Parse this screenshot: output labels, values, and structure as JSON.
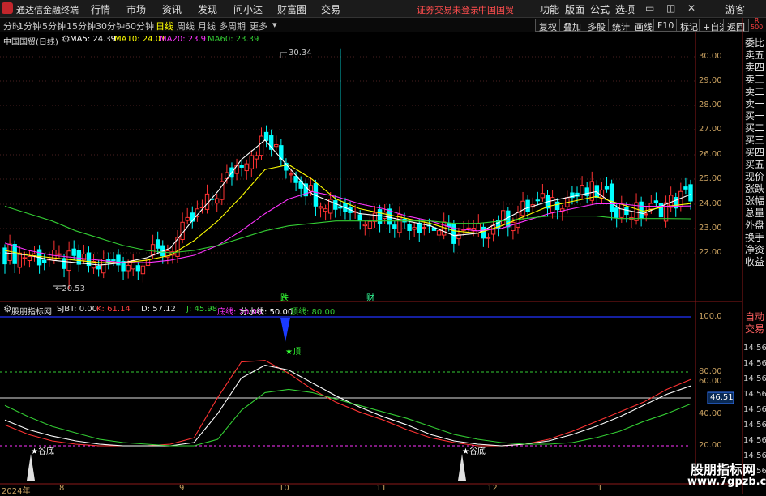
{
  "titlebar": {
    "app_name": "通达信金融终端",
    "menus": [
      "行情",
      "市场",
      "资讯",
      "发现",
      "问小达",
      "财富圈",
      "交易"
    ],
    "notice": "证券交易未登录",
    "stock": "中国国贸",
    "right_menus": [
      "功能",
      "版面",
      "公式",
      "选项"
    ],
    "user": "游客"
  },
  "toolbar": {
    "timeframes": [
      "分时",
      "1分钟",
      "5分钟",
      "15分钟",
      "30分钟",
      "60分钟",
      "日线",
      "周线",
      "月线",
      "多周期",
      "更多"
    ],
    "active_timeframe": "日线",
    "buttons": [
      "复权",
      "叠加",
      "多股",
      "统计",
      "画线",
      "F10",
      "标记",
      "+自选",
      "返回"
    ]
  },
  "main_chart": {
    "title": "中国国贸(日线)",
    "ma_labels": [
      {
        "text": "MA5: 24.39",
        "color": "#ffffff"
      },
      {
        "text": "MA10: 24.01",
        "color": "#ffff00"
      },
      {
        "text": "MA20: 23.91",
        "color": "#ff33ff"
      },
      {
        "text": "MA60: 23.39",
        "color": "#33cc33"
      }
    ],
    "price_axis": [
      "30.00",
      "29.00",
      "28.00",
      "27.00",
      "26.00",
      "25.00",
      "24.00",
      "23.00",
      "22.00"
    ],
    "high_label": "30.34",
    "low_label": "20.53",
    "events": [
      "跌",
      "财"
    ]
  },
  "indicator": {
    "title": "股朋指标网",
    "values": [
      {
        "text": "SJBT: 0.00",
        "color": "#e0e0e0"
      },
      {
        "text": "K: 61.14",
        "color": "#ff4040"
      },
      {
        "text": "D: 57.12",
        "color": "#e0e0e0"
      },
      {
        "text": "J: 45.98",
        "color": "#33cc33"
      },
      {
        "text": "底线: 20.00",
        "color": "#ff33ff"
      },
      {
        "text": "分水线: 50.00",
        "color": "#ffffff"
      },
      {
        "text": "顶线: 80.00",
        "color": "#33cc33"
      }
    ],
    "axis": [
      "100.0",
      "80.00",
      "60.00",
      "40.00",
      "20.00"
    ],
    "current_value": "46.51",
    "top_signal": "顶",
    "bottom_signals": [
      "谷底",
      "谷底"
    ]
  },
  "date_axis": [
    "2024年",
    "8",
    "9",
    "10",
    "11",
    "12",
    "1"
  ],
  "right_panel": {
    "header": "R\n500",
    "items": [
      "委比",
      "卖五",
      "卖四",
      "卖三",
      "卖二",
      "卖一",
      "买一",
      "买二",
      "买三",
      "买四",
      "买五",
      "现价",
      "涨跌",
      "涨幅",
      "总量",
      "外盘",
      "换手",
      "净资",
      "收益"
    ],
    "lower": [
      "自动",
      "交易"
    ],
    "times": [
      "14:56",
      "14:56",
      "14:56",
      "14:56",
      "14:56",
      "14:56",
      "14:56",
      "14:56",
      "14:56",
      "14:56"
    ]
  },
  "watermark": {
    "name": "股朋指标网",
    "url": "www.7gpzb.com"
  },
  "colors": {
    "up": "#ff3333",
    "down": "#00ffff",
    "ma5": "#ffffff",
    "ma10": "#ffff00",
    "ma20": "#ff33ff",
    "ma60": "#33cc33",
    "axis_text": "#c8a060",
    "notice": "#ff4d4d"
  },
  "chart_data": [
    {
      "type": "candlestick",
      "title": "中国国贸(日线)",
      "y_range": [
        20.0,
        30.5
      ],
      "series": [
        {
          "name": "MA5",
          "values": [
            22.0,
            21.9,
            21.7,
            21.6,
            21.5,
            21.6,
            21.8,
            22.2,
            23.4,
            24.5,
            25.8,
            26.6,
            25.5,
            24.4,
            24.0,
            23.6,
            23.5,
            23.3,
            23.1,
            22.7,
            22.8,
            23.3,
            23.8,
            24.1,
            24.3,
            24.5,
            23.8,
            23.6,
            24.0,
            24.39
          ]
        },
        {
          "name": "MA10",
          "values": [
            22.1,
            21.9,
            21.8,
            21.7,
            21.6,
            21.6,
            21.7,
            21.9,
            22.5,
            23.3,
            24.3,
            25.4,
            25.6,
            25.0,
            24.2,
            23.8,
            23.6,
            23.4,
            23.2,
            22.9,
            22.8,
            23.1,
            23.5,
            23.9,
            24.1,
            24.3,
            24.0,
            23.7,
            23.9,
            24.01
          ]
        },
        {
          "name": "MA20",
          "values": [
            22.4,
            22.1,
            21.9,
            21.8,
            21.7,
            21.6,
            21.6,
            21.7,
            21.9,
            22.3,
            22.9,
            23.6,
            24.2,
            24.5,
            24.3,
            24.0,
            23.8,
            23.5,
            23.3,
            23.0,
            22.9,
            23.0,
            23.3,
            23.6,
            23.8,
            24.0,
            24.0,
            23.9,
            23.9,
            23.91
          ]
        },
        {
          "name": "MA60",
          "values": [
            23.9,
            23.6,
            23.3,
            22.9,
            22.6,
            22.3,
            22.1,
            22.0,
            22.1,
            22.3,
            22.6,
            22.9,
            23.1,
            23.2,
            23.3,
            23.3,
            23.3,
            23.3,
            23.3,
            23.2,
            23.2,
            23.3,
            23.4,
            23.5,
            23.5,
            23.5,
            23.4,
            23.4,
            23.4,
            23.39
          ]
        }
      ]
    },
    {
      "type": "line",
      "title": "股朋指标网",
      "y_range": [
        10,
        105
      ],
      "series": [
        {
          "name": "K",
          "values": [
            33,
            27,
            23,
            21,
            20,
            20,
            20,
            21,
            25,
            50,
            72,
            73,
            65,
            55,
            47,
            41,
            36,
            30,
            25,
            22,
            20,
            20,
            21,
            24,
            29,
            35,
            41,
            47,
            55,
            61.14
          ]
        },
        {
          "name": "D",
          "values": [
            36,
            30,
            26,
            23,
            21,
            20,
            20,
            20,
            22,
            40,
            62,
            70,
            67,
            59,
            51,
            44,
            38,
            33,
            27,
            23,
            21,
            20,
            21,
            23,
            27,
            32,
            38,
            45,
            52,
            57.12
          ]
        },
        {
          "name": "J",
          "values": [
            45,
            38,
            32,
            28,
            24,
            22,
            21,
            20,
            20,
            24,
            42,
            53,
            55,
            53,
            49,
            45,
            41,
            37,
            32,
            27,
            24,
            22,
            21,
            21,
            22,
            25,
            29,
            35,
            40,
            45.98
          ]
        }
      ]
    }
  ]
}
